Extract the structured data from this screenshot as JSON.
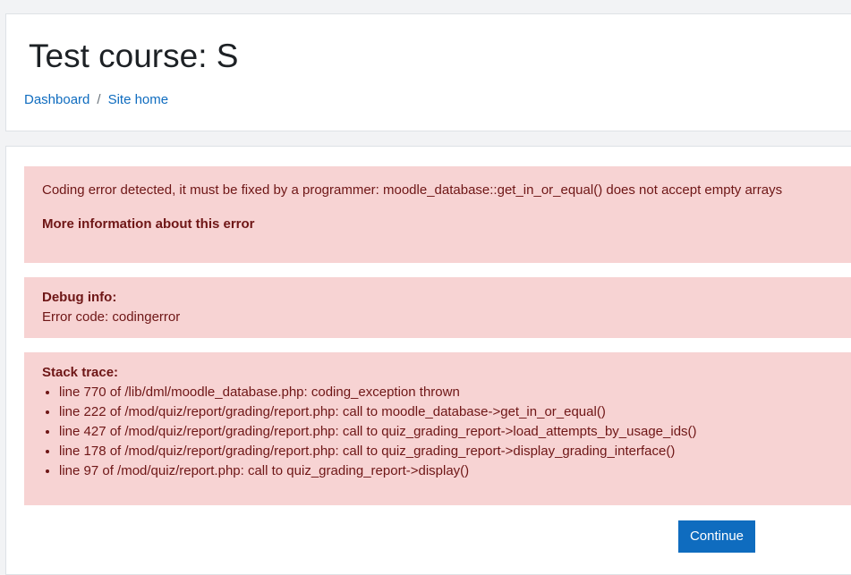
{
  "header": {
    "title": "Test course: S",
    "breadcrumb": [
      {
        "label": "Dashboard"
      },
      {
        "label": "Site home"
      }
    ],
    "separator": "/"
  },
  "error": {
    "message": "Coding error detected, it must be fixed by a programmer: moodle_database::get_in_or_equal() does not accept empty arrays",
    "more_info_label": "More information about this error"
  },
  "debug": {
    "title": "Debug info:",
    "code_text": "Error code: codingerror"
  },
  "stack": {
    "title": "Stack trace:",
    "items": [
      "line 770 of /lib/dml/moodle_database.php: coding_exception thrown",
      "line 222 of /mod/quiz/report/grading/report.php: call to moodle_database->get_in_or_equal()",
      "line 427 of /mod/quiz/report/grading/report.php: call to quiz_grading_report->load_attempts_by_usage_ids()",
      "line 178 of /mod/quiz/report/grading/report.php: call to quiz_grading_report->display_grading_interface()",
      "line 97 of /mod/quiz/report.php: call to quiz_grading_report->display()"
    ]
  },
  "actions": {
    "continue_label": "Continue"
  },
  "colors": {
    "accent": "#0f6cbf",
    "alert_bg": "#f7d3d3",
    "alert_text": "#6e1616",
    "page_bg": "#f2f3f5"
  }
}
